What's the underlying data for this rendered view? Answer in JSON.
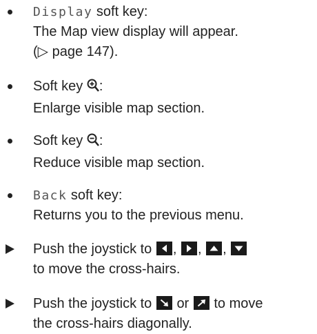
{
  "items": [
    {
      "key_name": "Display",
      "heading_rest": " soft key:",
      "desc": "The Map view display will appear.",
      "ref_arrow": "▷",
      "ref_page": " page 147)."
    },
    {
      "heading": "Soft key",
      "icon": "zoom-in-icon",
      "colon": ":",
      "desc": "Enlarge visible map section."
    },
    {
      "heading": "Soft key",
      "icon": "zoom-out-icon",
      "colon": ":",
      "desc": "Reduce visible map section."
    },
    {
      "key_name": "Back",
      "heading_rest": " soft key:",
      "desc": "Returns you to the previous menu."
    }
  ],
  "steps": [
    {
      "text_before": "Push the joystick to",
      "sep": ",",
      "keys": [
        "left-arrow-key-icon",
        "right-arrow-key-icon",
        "up-arrow-key-icon",
        "down-arrow-key-icon"
      ],
      "line2": "to move the cross-hairs."
    },
    {
      "text_before": "Push the joystick to",
      "or_text": "or",
      "text_after": "to move",
      "keys": [
        "diagonal-down-right-key-icon",
        "diagonal-up-right-key-icon"
      ],
      "line2": "the cross-hairs diagonally."
    }
  ]
}
